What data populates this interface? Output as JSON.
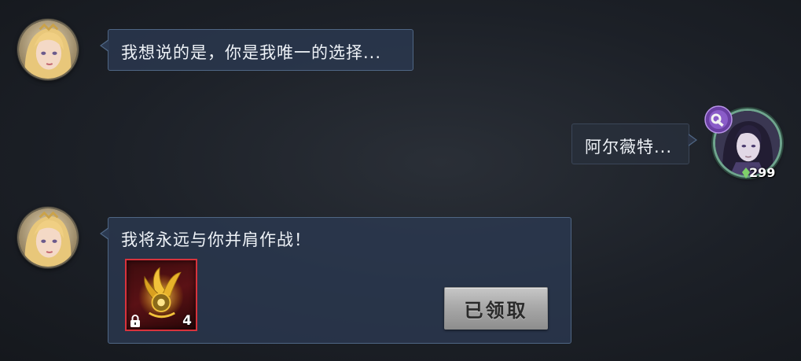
{
  "messages": [
    {
      "sender": "npc",
      "text": "我想说的是，你是我唯一的选择..."
    },
    {
      "sender": "player",
      "text": "阿尔薇特..."
    },
    {
      "sender": "npc",
      "text": "我将永远与你并肩作战！",
      "reward": {
        "item_icon": "golden-wing-ornament-icon",
        "count": "4",
        "locked": true,
        "claim_label": "已领取"
      }
    }
  ],
  "player": {
    "level": "299",
    "class_icon": "gear-wrench-class-icon"
  },
  "colors": {
    "bubble_bg": "#2c3a52",
    "bubble_border": "#4f6684",
    "item_frame": "#d8333c",
    "player_ring": "#6fa58e",
    "class_badge": "#7a4bb5"
  }
}
